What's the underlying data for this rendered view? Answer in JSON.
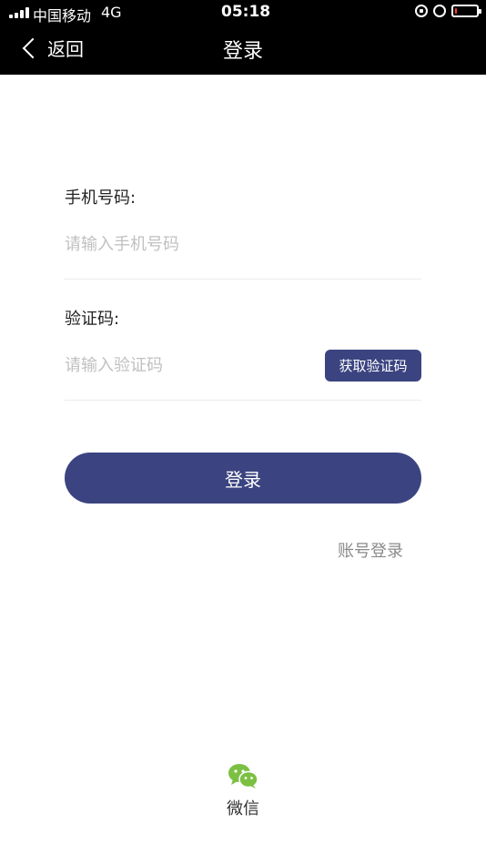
{
  "status_bar": {
    "carrier": "中国移动",
    "network": "4G",
    "time": "05:18",
    "battery_level": 0.1,
    "battery_color": "#ff3b30"
  },
  "nav": {
    "back_label": "返回",
    "title": "登录"
  },
  "form": {
    "phone": {
      "label": "手机号码:",
      "value": "",
      "placeholder": "请输入手机号码"
    },
    "code": {
      "label": "验证码:",
      "value": "",
      "placeholder": "请输入验证码",
      "send_button_label": "获取验证码"
    },
    "submit_label": "登录"
  },
  "account_login_label": "账号登录",
  "social": {
    "wechat_label": "微信",
    "wechat_color": "#7bc043"
  },
  "colors": {
    "accent": "#3b4480",
    "topbar": "#000000"
  },
  "icons": [
    "signal-icon",
    "rotation-lock-icon",
    "alarm-icon",
    "battery-icon",
    "back-chevron-icon",
    "wechat-icon"
  ]
}
